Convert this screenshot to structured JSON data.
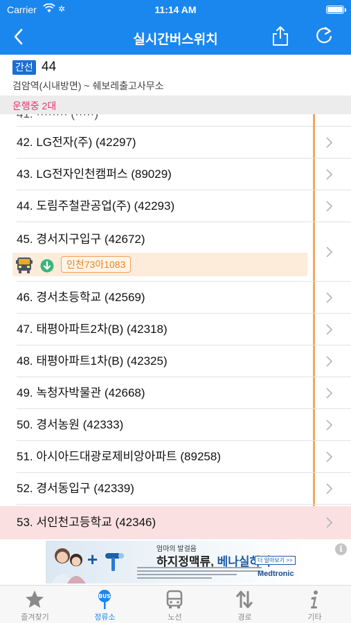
{
  "status_bar": {
    "carrier": "Carrier",
    "time": "11:14 AM"
  },
  "nav": {
    "title": "실시간버스위치"
  },
  "route": {
    "type_badge": "간선",
    "number": "44",
    "description": "검암역(시내방면) ~ 쉐보레출고사무소"
  },
  "running": {
    "label": "운행중 2대"
  },
  "stops": [
    {
      "label": "42. LG전자(주) (42297)"
    },
    {
      "label": "43. LG전자인천캠퍼스 (89029)"
    },
    {
      "label": "44. 도림주철관공업(주) (42293)"
    },
    {
      "label": "45. 경서지구입구 (42672)"
    },
    {
      "label": "46. 경서초등학교 (42569)"
    },
    {
      "label": "47. 태평아파트2차(B) (42318)"
    },
    {
      "label": "48. 태평아파트1차(B) (42325)"
    },
    {
      "label": "49. 녹청자박물관 (42668)"
    },
    {
      "label": "50. 경서농원 (42333)"
    },
    {
      "label": "51. 아시아드대광로제비앙아파트 (89258)"
    },
    {
      "label": "52. 경서동입구 (42339)"
    },
    {
      "label": "53. 서인천고등학교 (42346)"
    }
  ],
  "bus": {
    "plate": "인천73아1083"
  },
  "ad": {
    "kicker": "엄마의 발걸음",
    "headline_main": "하지정맥류, ",
    "headline_accent": "베나실하다",
    "more_button": "더 알아보기 >>",
    "brand": "Medtronic",
    "info": "i"
  },
  "tabs": [
    {
      "label": "즐겨찾기",
      "icon": "star-icon"
    },
    {
      "label": "정류소",
      "icon": "bus-stop-icon"
    },
    {
      "label": "노선",
      "icon": "bus-icon"
    },
    {
      "label": "경로",
      "icon": "route-arrows-icon"
    },
    {
      "label": "기타",
      "icon": "info-icon"
    }
  ],
  "colors": {
    "primary": "#1a87ef",
    "running_text": "#e8336b",
    "route_line": "#f6a55b",
    "highlight_row": "#fbe0e1",
    "bus_strip": "#fdecd9"
  }
}
